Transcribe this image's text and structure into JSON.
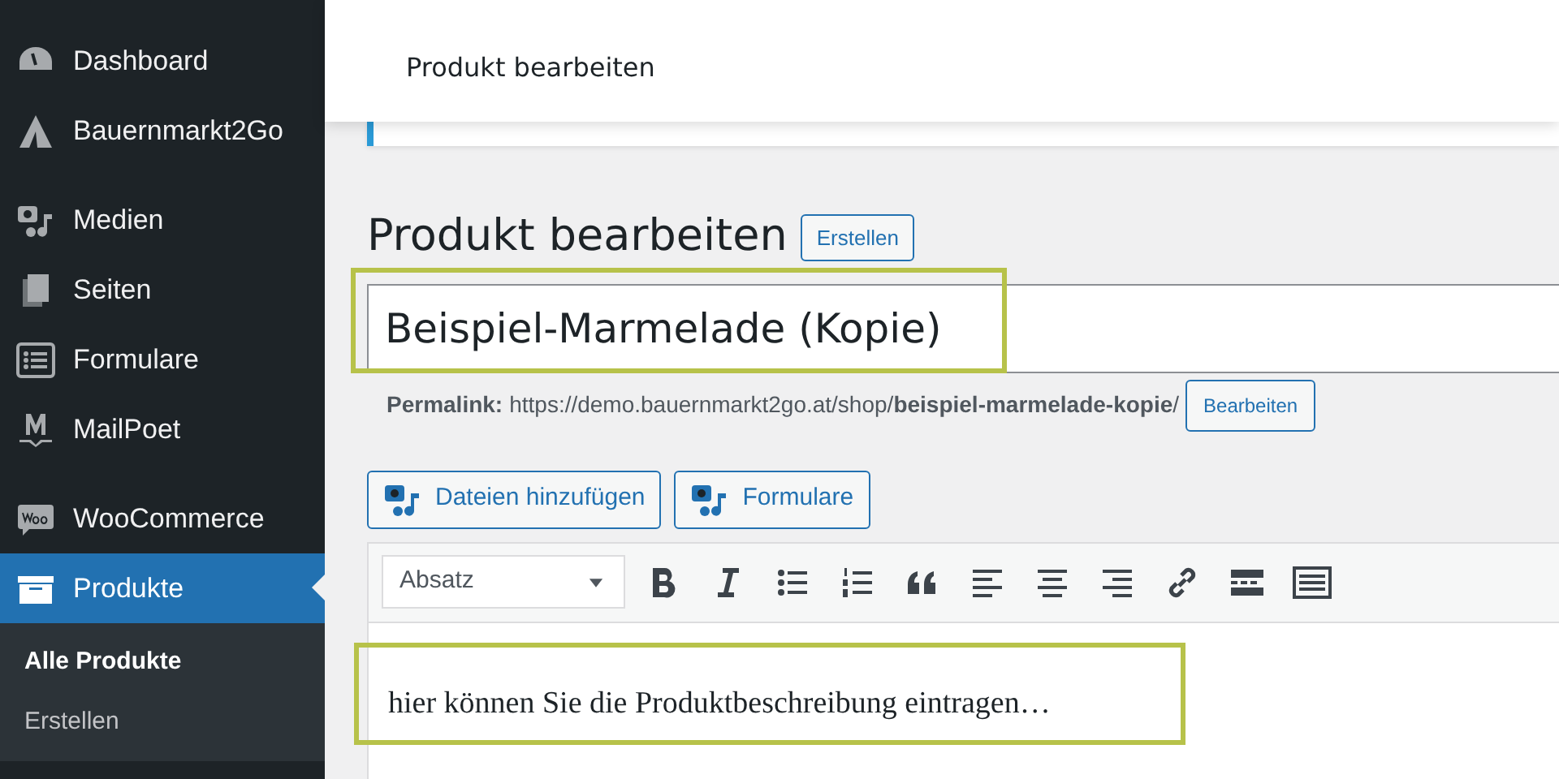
{
  "sidebar": {
    "groups": [
      [
        {
          "label": "Dashboard",
          "selected": false
        },
        {
          "label": "Bauernmarkt2Go",
          "selected": false
        }
      ],
      [
        {
          "label": "Medien",
          "selected": false
        },
        {
          "label": "Seiten",
          "selected": false
        },
        {
          "label": "Formulare",
          "selected": false
        },
        {
          "label": "MailPoet",
          "selected": false
        }
      ],
      [
        {
          "label": "WooCommerce",
          "selected": false
        },
        {
          "label": "Produkte",
          "selected": true,
          "children": [
            {
              "label": "Alle Produkte",
              "selected": true
            },
            {
              "label": "Erstellen",
              "selected": false
            }
          ]
        }
      ]
    ]
  },
  "header": {
    "title": "Produkt bearbeiten"
  },
  "page": {
    "heading": "Produkt bearbeiten",
    "add_button": "Erstellen"
  },
  "title_field": {
    "value": "Beispiel-Marmelade (Kopie)",
    "highlighted": true
  },
  "permalink": {
    "label": "Permalink:",
    "url": "https://demo.bauernmarkt2go.at/shop/**beispiel-marmelade-kopie**/",
    "edit_button": "Bearbeiten"
  },
  "media_buttons": [
    "Dateien hinzufügen",
    "Formulare"
  ],
  "editor": {
    "format": "Absatz",
    "content": "hier können Sie die Produktbeschreibung eintragen…",
    "highlighted": true
  }
}
